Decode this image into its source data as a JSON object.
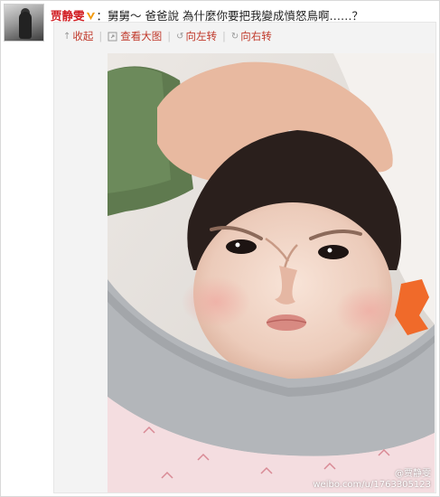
{
  "post": {
    "author": "贾静雯",
    "text": "：舅舅～ 爸爸說 為什麼你要把我變成憤怒鳥啊……？"
  },
  "toolbar": {
    "collapse": "收起",
    "view_large": "查看大图",
    "rotate_left": "向左转",
    "rotate_right": "向右转"
  },
  "photo": {
    "watermark_name": "@贾静雯",
    "watermark_url": "weibo.com/u/1763305123"
  },
  "colors": {
    "author": "#d0191e",
    "action_link": "#c0392b",
    "verified_badge": "#f29a0f"
  },
  "icons": [
    "collapse-arrow-icon",
    "zoom-icon",
    "rotate-left-icon",
    "rotate-right-icon",
    "verified-badge-icon"
  ]
}
